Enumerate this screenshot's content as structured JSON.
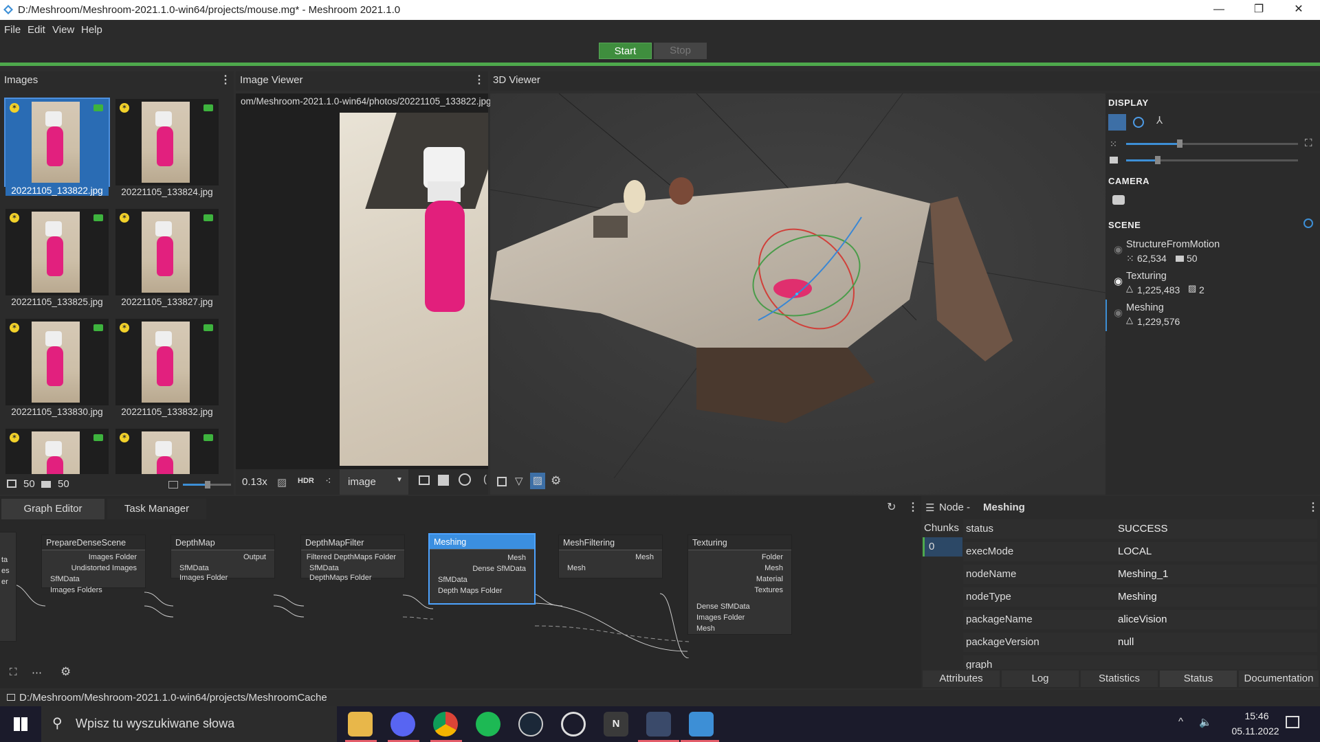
{
  "window": {
    "title": "D:/Meshroom/Meshroom-2021.1.0-win64/projects/mouse.mg* - Meshroom 2021.1.0",
    "minimize": "—",
    "restore": "❐",
    "close": "✕"
  },
  "menu": {
    "file": "File",
    "edit": "Edit",
    "view": "View",
    "help": "Help"
  },
  "toolbar": {
    "start": "Start",
    "stop": "Stop"
  },
  "images_panel": {
    "title": "Images",
    "images": [
      "20221105_133822.jpg",
      "20221105_133824.jpg",
      "20221105_133825.jpg",
      "20221105_133827.jpg",
      "20221105_133830.jpg",
      "20221105_133832.jpg"
    ],
    "image_count": "50",
    "camera_count": "50"
  },
  "image_viewer": {
    "title": "Image Viewer",
    "path": "om/Meshroom-2021.1.0-win64/photos/20221105_133822.jpg",
    "zoom": "0.13x",
    "hdr": "HDR",
    "mode": "image"
  },
  "viewer3d": {
    "title": "3D Viewer",
    "display": "DISPLAY",
    "camera": "CAMERA",
    "scene": "SCENE",
    "scene_items": [
      {
        "name": "StructureFromMotion",
        "stat1": "62,534",
        "stat2": "50"
      },
      {
        "name": "Texturing",
        "stat1": "1,225,483",
        "stat2": "2"
      },
      {
        "name": "Meshing",
        "stat1": "1,229,576",
        "stat2": ""
      }
    ]
  },
  "tabs": {
    "graph_editor": "Graph Editor",
    "task_manager": "Task Manager"
  },
  "graph": {
    "nodes": {
      "prepare": {
        "title": "PrepareDenseScene",
        "out1": "Images Folder",
        "out2": "Undistorted Images",
        "in1": "SfMData",
        "in2": "Images Folders"
      },
      "depthmap": {
        "title": "DepthMap",
        "out1": "Output",
        "in1": "SfMData",
        "in2": "Images Folder"
      },
      "depthfilter": {
        "title": "DepthMapFilter",
        "out1": "Filtered DepthMaps Folder",
        "in1": "SfMData",
        "in2": "DepthMaps Folder"
      },
      "meshing": {
        "title": "Meshing",
        "out1": "Mesh",
        "out2": "Dense SfMData",
        "in1": "SfMData",
        "in2": "Depth Maps Folder"
      },
      "meshfilter": {
        "title": "MeshFiltering",
        "out1": "Mesh",
        "in1": "Mesh"
      },
      "texturing": {
        "title": "Texturing",
        "out1": "Folder",
        "out2": "Mesh",
        "out3": "Material",
        "out4": "Textures",
        "in1": "Dense SfMData",
        "in2": "Images Folder",
        "in3": "Mesh"
      }
    },
    "left_stub": [
      "ta",
      "es",
      "er"
    ]
  },
  "node_panel": {
    "prefix": "Node - ",
    "name": "Meshing",
    "chunks_label": "Chunks",
    "chunk": "0",
    "attributes": [
      {
        "key": "status",
        "value": "SUCCESS"
      },
      {
        "key": "execMode",
        "value": "LOCAL"
      },
      {
        "key": "nodeName",
        "value": "Meshing_1"
      },
      {
        "key": "nodeType",
        "value": "Meshing"
      },
      {
        "key": "packageName",
        "value": "aliceVision"
      },
      {
        "key": "packageVersion",
        "value": "null"
      },
      {
        "key": "graph",
        "value": ""
      }
    ],
    "tabs": [
      "Attributes",
      "Log",
      "Statistics",
      "Status",
      "Documentation"
    ]
  },
  "statusbar": {
    "path": "D:/Meshroom/Meshroom-2021.1.0-win64/projects/MeshroomCache"
  },
  "taskbar": {
    "search_placeholder": "Wpisz tu wyszukiwane słowa",
    "time": "15:46",
    "date": "05.11.2022"
  },
  "colors": {
    "accent_green": "#4ea94c",
    "selection_blue": "#2a6cb4",
    "node_select": "#4da3ff"
  }
}
